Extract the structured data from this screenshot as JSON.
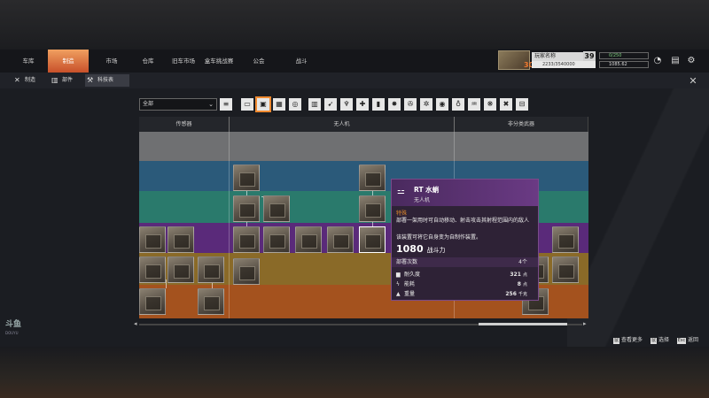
{
  "nav": {
    "tabs": [
      {
        "label": "车库"
      },
      {
        "label": "制造"
      },
      {
        "label": "市场"
      },
      {
        "label": "仓库"
      },
      {
        "label": "旧车市场"
      },
      {
        "label": "盒车挑战赛"
      },
      {
        "label": "公会"
      },
      {
        "label": "战斗"
      }
    ],
    "active_tab": "制造"
  },
  "subnav": {
    "tabs": [
      {
        "label": "制造",
        "icon": "wrench-icon"
      },
      {
        "label": "部件",
        "icon": "parts-icon"
      },
      {
        "label": "科技表",
        "icon": "tech-tree-icon"
      }
    ],
    "active_tab": "科技表"
  },
  "player": {
    "name": "玩家名称",
    "level": "39",
    "rank": "30",
    "xp": "2233/3540000",
    "resource1": "0/250",
    "resource2": "1085.62"
  },
  "filter": {
    "dropdown_value": "全部"
  },
  "tree": {
    "columns": [
      "传感器",
      "无人机",
      "非分类武器"
    ]
  },
  "tooltip": {
    "name": "RT 水蛸",
    "type": "无人机",
    "rarity": "特殊",
    "description": "部署一架用时可自动移动、射击攻击其射程范围内的敌人",
    "note": "该装置可将它自身变为自制作装置。",
    "power_value": "1080",
    "power_unit": "战斗力",
    "deploy_label": "部署次数",
    "deploy_value": "4个",
    "stats": [
      {
        "icon": "durability-icon",
        "label": "耐久度",
        "value": "321",
        "unit": "点"
      },
      {
        "icon": "energy-icon",
        "label": "能耗",
        "value": "8",
        "unit": "点"
      },
      {
        "icon": "weight-icon",
        "label": "重量",
        "value": "256",
        "unit": "千克"
      }
    ]
  },
  "footer": {
    "hints": [
      {
        "key": "鼠",
        "label": "查看更多"
      },
      {
        "key": "鼠",
        "label": "选择"
      },
      {
        "key": "Esc",
        "label": "返回"
      }
    ]
  },
  "logo": {
    "text": "斗鱼",
    "sub": "DOUYU"
  }
}
